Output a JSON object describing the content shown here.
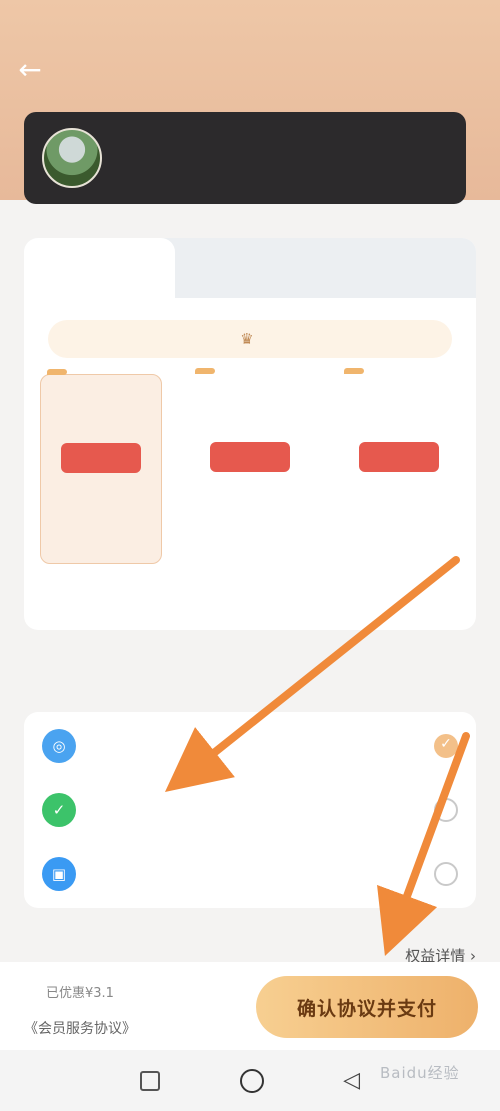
{
  "status_bar": {
    "time": "",
    "indicators": ""
  },
  "header": {
    "back_icon": "back-arrow-icon",
    "title": ""
  },
  "user": {
    "name": "",
    "subtitle": ""
  },
  "tabs": [
    {
      "label": ""
    },
    {
      "label": ""
    },
    {
      "label": ""
    }
  ],
  "notice": {
    "icon": "crown-icon",
    "text": ""
  },
  "plans": [
    {
      "badge": "",
      "name": "",
      "price": "",
      "original": "",
      "button": ""
    },
    {
      "badge": "",
      "name": "",
      "price": "",
      "original": "",
      "button": ""
    },
    {
      "badge": "",
      "name": "",
      "price": "",
      "original": "",
      "button": ""
    }
  ],
  "auto_renew_text": "",
  "payment": {
    "section_title": "",
    "methods": [
      {
        "label": "",
        "icon": "payment-icon-blue",
        "color": "#4aa3f0"
      },
      {
        "label": "",
        "icon": "wechat-pay-icon",
        "color": "#3cc36a"
      },
      {
        "label": "",
        "icon": "wallet-icon",
        "color": "#3a9af3"
      }
    ]
  },
  "privilege": {
    "title": "",
    "link": "权益详情 ›"
  },
  "checkout": {
    "total_label": "",
    "total_value": "",
    "discount": "已优惠¥3.1",
    "agreement_prefix": "",
    "agreement_link": "《会员服务协议》",
    "confirm_button": "确认协议并支付"
  },
  "watermark": "Baidu经验",
  "annotation_arrow_color": "#f08a3a",
  "colors": {
    "header": "#eec7a7",
    "accent_button": "#eeb16b",
    "plan_button": "#e6594e",
    "user_card": "#2c2a2c"
  }
}
